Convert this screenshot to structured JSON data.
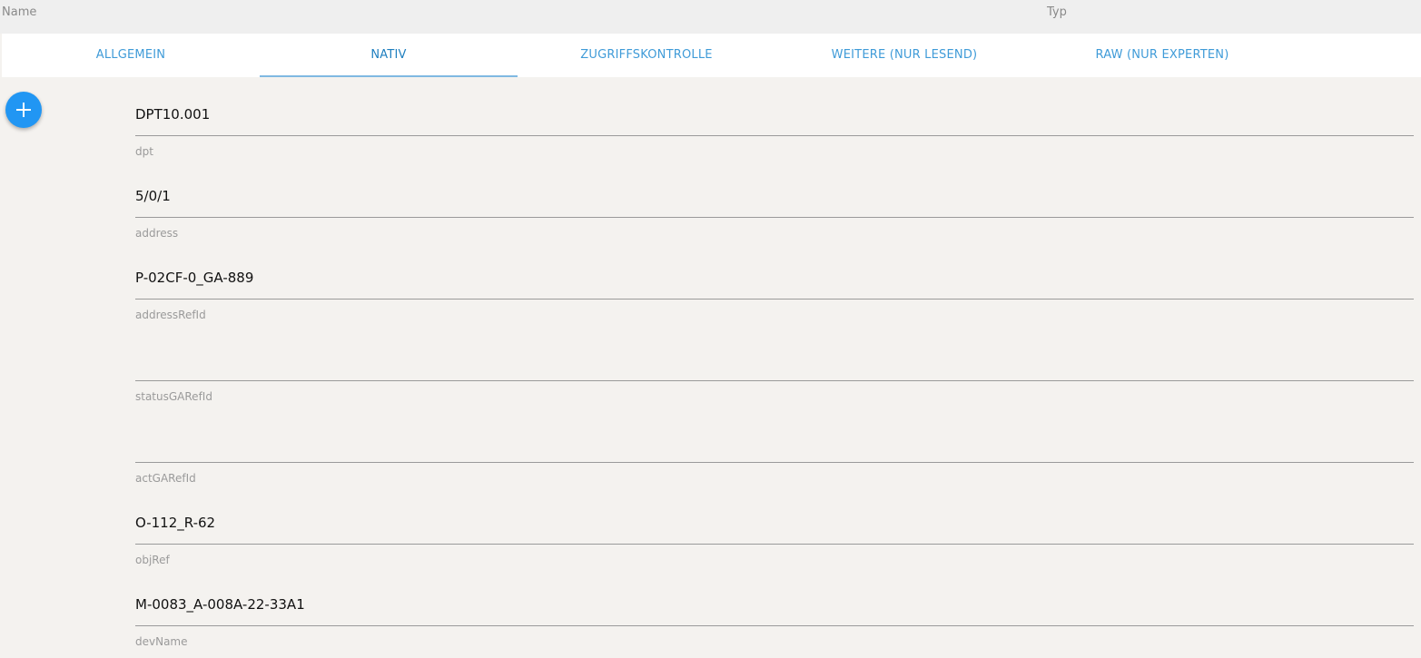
{
  "header": {
    "name_label": "Name",
    "type_label": "Typ"
  },
  "tabs": [
    {
      "label": "ALLGEMEIN"
    },
    {
      "label": "NATIV",
      "active": true
    },
    {
      "label": "ZUGRIFFSKONTROLLE"
    },
    {
      "label": "WEITERE (NUR LESEND)"
    },
    {
      "label": "RAW (NUR EXPERTEN)"
    }
  ],
  "fab": {
    "icon": "plus-icon"
  },
  "fields": [
    {
      "value": "DPT10.001",
      "label": "dpt"
    },
    {
      "value": "5/0/1",
      "label": "address"
    },
    {
      "value": "P-02CF-0_GA-889",
      "label": "addressRefId"
    },
    {
      "value": "",
      "label": "statusGARefId"
    },
    {
      "value": "",
      "label": "actGARefId"
    },
    {
      "value": "O-112_R-62",
      "label": "objRef"
    },
    {
      "value": "M-0083_A-008A-22-33A1",
      "label": "devName"
    }
  ],
  "colors": {
    "accent": "#2196f3",
    "tab_text": "#3f9bd8",
    "background": "#f4f2ef"
  }
}
